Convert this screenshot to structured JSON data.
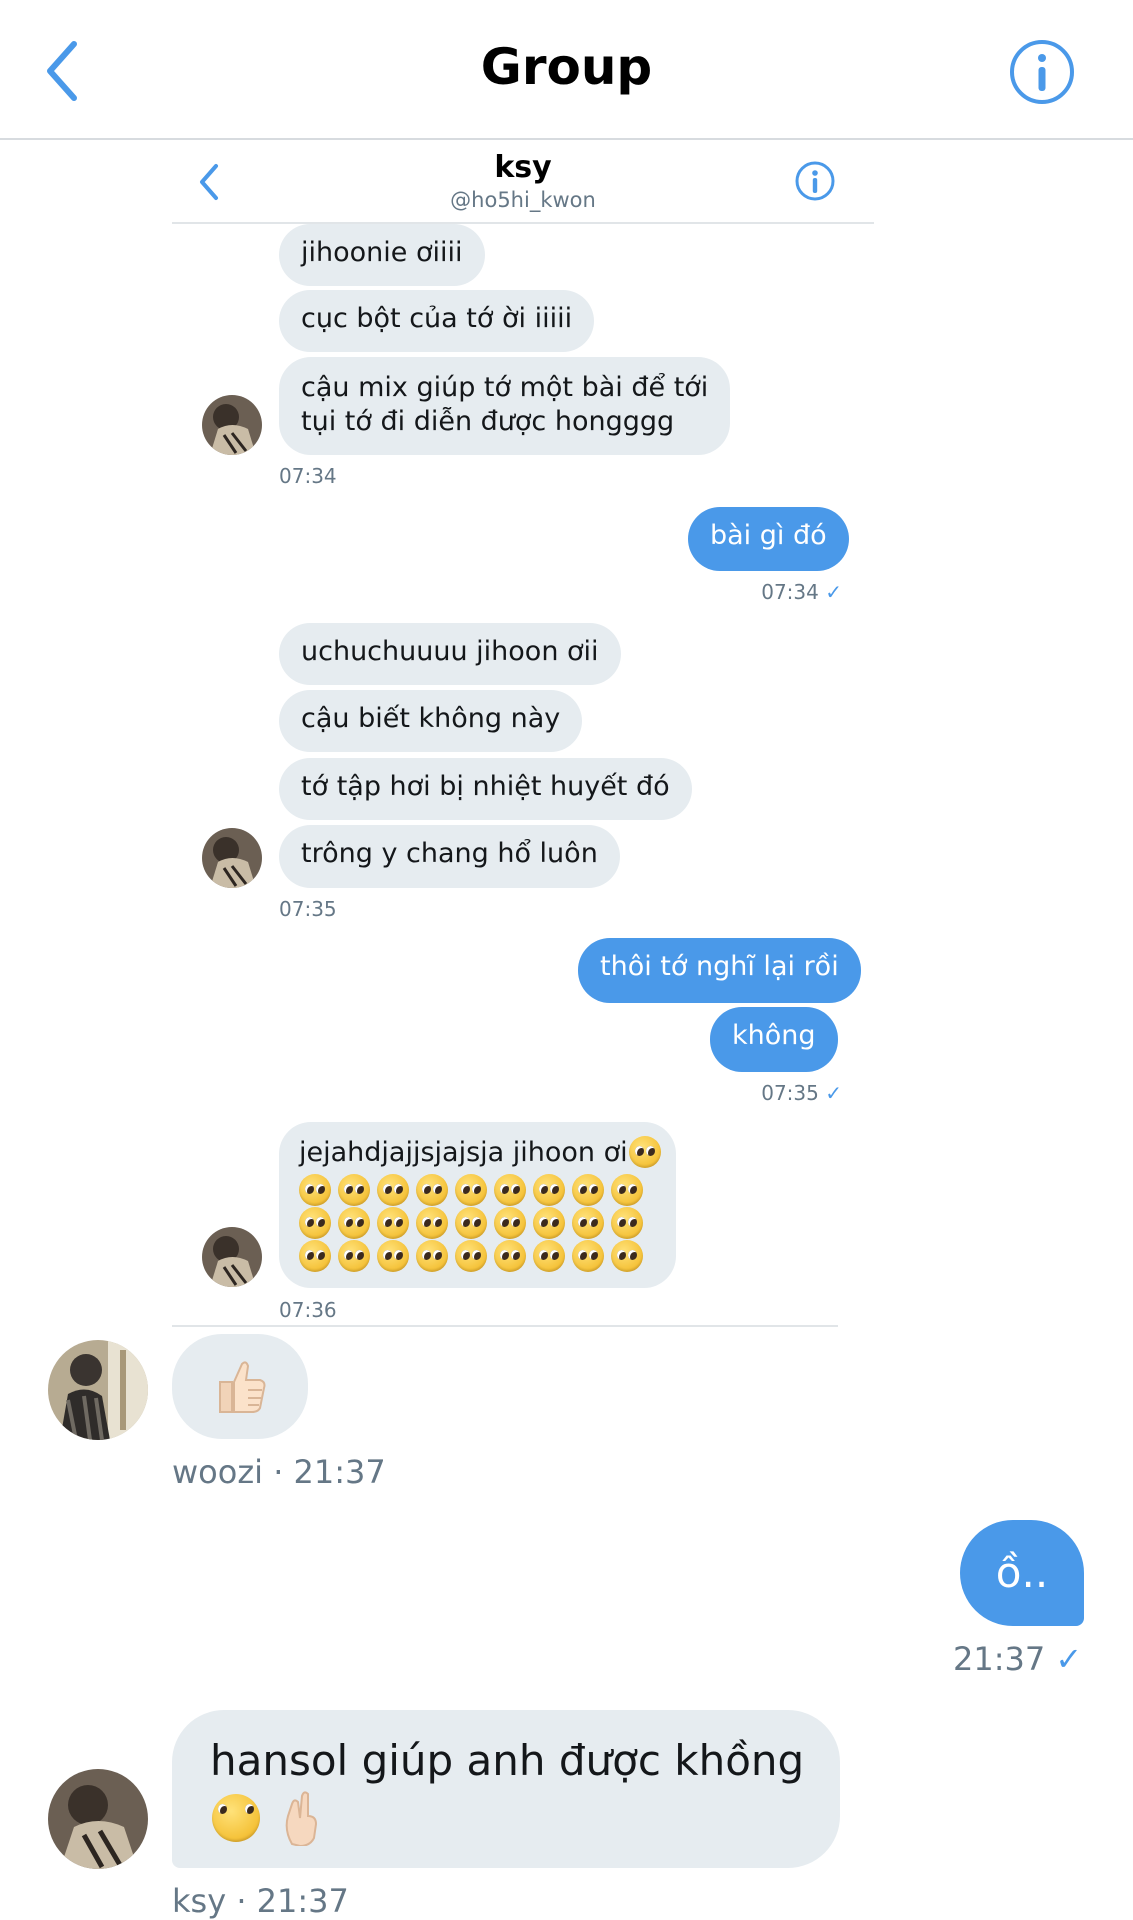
{
  "header": {
    "title": "Group"
  },
  "inner": {
    "name": "ksy",
    "handle": "@ho5hi_kwon",
    "messages": [
      {
        "text": "jihoonie ơiiii"
      },
      {
        "text": "cục bột của tớ ời iiiii"
      },
      {
        "text": "cậu mix giúp tớ một bài để tới"
      },
      {
        "text": "tụi tớ đi diễn được hongggg"
      },
      {
        "text": "bài gì đó"
      },
      {
        "text": "uchuchuuuu jihoon ơii"
      },
      {
        "text": "cậu biết không này"
      },
      {
        "text": "tớ tập hơi bị nhiệt huyết đó"
      },
      {
        "text": "trông y chang hổ luôn"
      },
      {
        "text": "thôi tớ nghĩ lại rồi"
      },
      {
        "text": "không"
      },
      {
        "text": "jejahdjajjsjajsja jihoon ơi"
      }
    ],
    "timestamps": {
      "t1": "07:34",
      "t2": "07:34",
      "t3": "07:35",
      "t4": "07:35",
      "t5": "07:36"
    }
  },
  "outer": {
    "woozi_meta": "woozi · 21:37",
    "my_message": "ồ..",
    "my_time": "21:37",
    "ksy_message": "hansol giúp anh được khồng",
    "ksy_meta": "ksy · 21:37"
  },
  "colors": {
    "accent": "#4a99e9",
    "bubble_gray": "#e6ecf0",
    "meta_gray": "#657786"
  }
}
